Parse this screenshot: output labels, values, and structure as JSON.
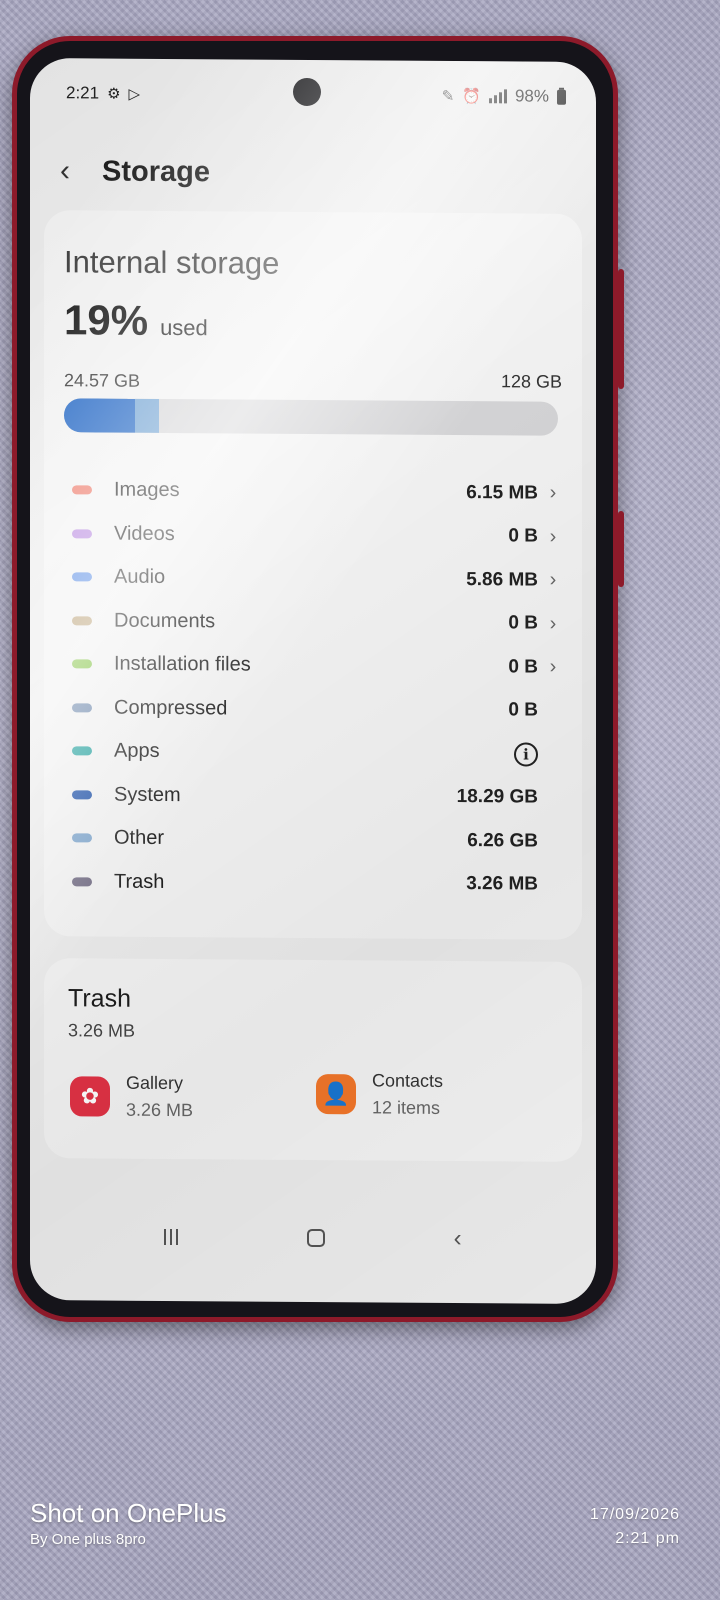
{
  "status_bar": {
    "time": "2:21",
    "battery": "98%",
    "left_icons": [
      "gear-icon",
      "play-store-icon"
    ],
    "right_icons": [
      "pen-icon",
      "alarm-icon",
      "signal-icon",
      "battery-icon"
    ]
  },
  "header": {
    "title": "Storage",
    "back_icon": "chevron-left-icon"
  },
  "storage": {
    "label": "Internal storage",
    "percent": "19%",
    "used_word": "used",
    "used_size": "24.57 GB",
    "total_size": "128 GB",
    "bar_segments": [
      {
        "name": "System",
        "fraction": 0.143,
        "color": "#1c63c4"
      },
      {
        "name": "Other",
        "fraction": 0.049,
        "color": "#6fa2d3"
      }
    ]
  },
  "categories": [
    {
      "label": "Images",
      "value": "6.15 MB",
      "color": "#ee7c6c",
      "chevron": true
    },
    {
      "label": "Videos",
      "value": "0 B",
      "color": "#b98be0",
      "chevron": true
    },
    {
      "label": "Audio",
      "value": "5.86 MB",
      "color": "#5b8fe6",
      "chevron": true
    },
    {
      "label": "Documents",
      "value": "0 B",
      "color": "#b99e72",
      "chevron": true
    },
    {
      "label": "Installation files",
      "value": "0 B",
      "color": "#7ec23b",
      "chevron": true
    },
    {
      "label": "Compressed",
      "value": "0 B",
      "color": "#6d88ad",
      "chevron": false
    },
    {
      "label": "Apps",
      "value": "",
      "color": "#24a3a0",
      "chevron": false,
      "info_icon": true
    },
    {
      "label": "System",
      "value": "18.29 GB",
      "color": "#1a4fa8",
      "chevron": false
    },
    {
      "label": "Other",
      "value": "6.26 GB",
      "color": "#7ca4cc",
      "chevron": false
    },
    {
      "label": "Trash",
      "value": "3.26 MB",
      "color": "#726c84",
      "chevron": false
    }
  ],
  "trash": {
    "title": "Trash",
    "size": "3.26 MB",
    "apps": [
      {
        "name": "Gallery",
        "detail": "3.26 MB",
        "icon": "gallery-icon",
        "color": "#e13245"
      },
      {
        "name": "Contacts",
        "detail": "12 items",
        "icon": "contacts-icon",
        "color": "#f2762a"
      }
    ]
  },
  "navbar": {
    "icons": [
      "recents-icon",
      "home-icon",
      "back-icon"
    ]
  },
  "photo_watermark": {
    "title": "Shot on OnePlus",
    "subtitle": "By One plus 8pro",
    "date": "17/09/2026",
    "time": "2:21 pm"
  }
}
